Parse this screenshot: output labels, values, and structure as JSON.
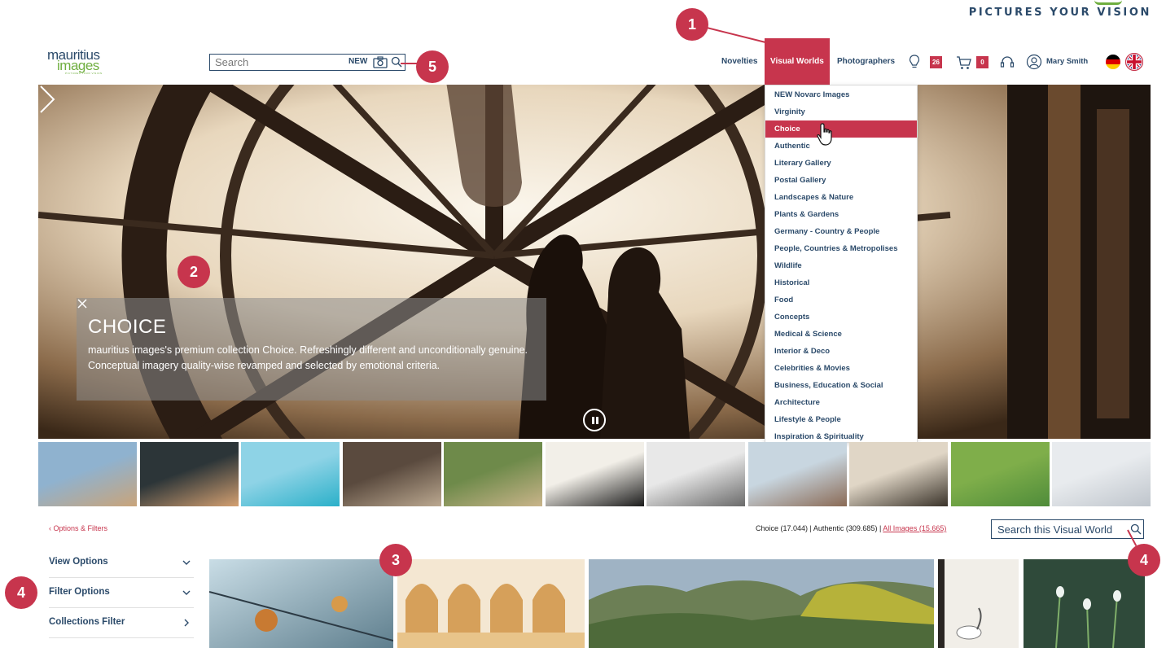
{
  "brand": {
    "tagline": "PICTURES YOUR VISION",
    "logo_line1": "mauritius",
    "logo_line2": "images",
    "logo_sub": "PICTURES YOUR VISION"
  },
  "search": {
    "placeholder": "Search",
    "new_label": "NEW"
  },
  "nav": {
    "novelties": "Novelties",
    "visual_worlds": "Visual Worlds",
    "photographers": "Photographers",
    "lightbox_count": "26",
    "cart_count": "0",
    "user_name": "Mary Smith"
  },
  "hero": {
    "caption_title": "CHOICE",
    "caption_text": "mauritius images's premium collection Choice. Refreshingly different and unconditionally genuine. Conceptual imagery quality-wise revamped and selected by emotional criteria."
  },
  "dropdown": {
    "items": [
      "NEW Novarc Images",
      "Virginity",
      "Choice",
      "Authentic",
      "Literary Gallery",
      "Postal Gallery",
      "Landscapes & Nature",
      "Plants & Gardens",
      "Germany - Country & People",
      "People, Countries & Metropolises",
      "Wildlife",
      "Historical",
      "Food",
      "Concepts",
      "Medical & Science",
      "Interior & Deco",
      "Celebrities & Movies",
      "Business, Education & Social",
      "Architecture",
      "Lifestyle & People",
      "Inspiration & Spirituality"
    ],
    "active_index": 2
  },
  "thumbnails": [
    {
      "name": "thumb-man-desert",
      "colors": [
        "#8fb2cf",
        "#c9a47a"
      ]
    },
    {
      "name": "thumb-selfie",
      "colors": [
        "#2c3538",
        "#d4a071"
      ]
    },
    {
      "name": "thumb-pool",
      "colors": [
        "#8ed3e6",
        "#2bb0c9"
      ]
    },
    {
      "name": "thumb-fence",
      "colors": [
        "#5a4a3e",
        "#bba890"
      ]
    },
    {
      "name": "thumb-picnic",
      "colors": [
        "#6e8a4a",
        "#c9b48a"
      ]
    },
    {
      "name": "thumb-clock",
      "colors": [
        "#f2efe8",
        "#1b1b1b"
      ]
    },
    {
      "name": "thumb-feathers",
      "colors": [
        "#e8e8e8",
        "#6a6a6a"
      ]
    },
    {
      "name": "thumb-elderly-man",
      "colors": [
        "#c8d6e0",
        "#8a6a55"
      ]
    },
    {
      "name": "thumb-silhouette",
      "colors": [
        "#e0d6c6",
        "#3a332a"
      ]
    },
    {
      "name": "thumb-river-aerial",
      "colors": [
        "#7fae4a",
        "#4f8c3a"
      ]
    },
    {
      "name": "thumb-elephant-snow",
      "colors": [
        "#e8ebee",
        "#bfc5cc"
      ]
    }
  ],
  "bottom": {
    "crumb": "‹ Options & Filters",
    "count_choice": "Choice (17.044)",
    "count_authentic": "Authentic (309.685)",
    "count_all": "All Images (15.665)",
    "separator": " | ",
    "vw_search_placeholder": "Search this Visual World",
    "side_options": [
      "View Options",
      "Filter Options",
      "Collections Filter"
    ]
  },
  "markers": [
    "1",
    "2",
    "3",
    "4",
    "4",
    "5"
  ],
  "colors": {
    "accent": "#c7354d",
    "navy": "#2b4a6a",
    "green": "#6fae3f"
  }
}
